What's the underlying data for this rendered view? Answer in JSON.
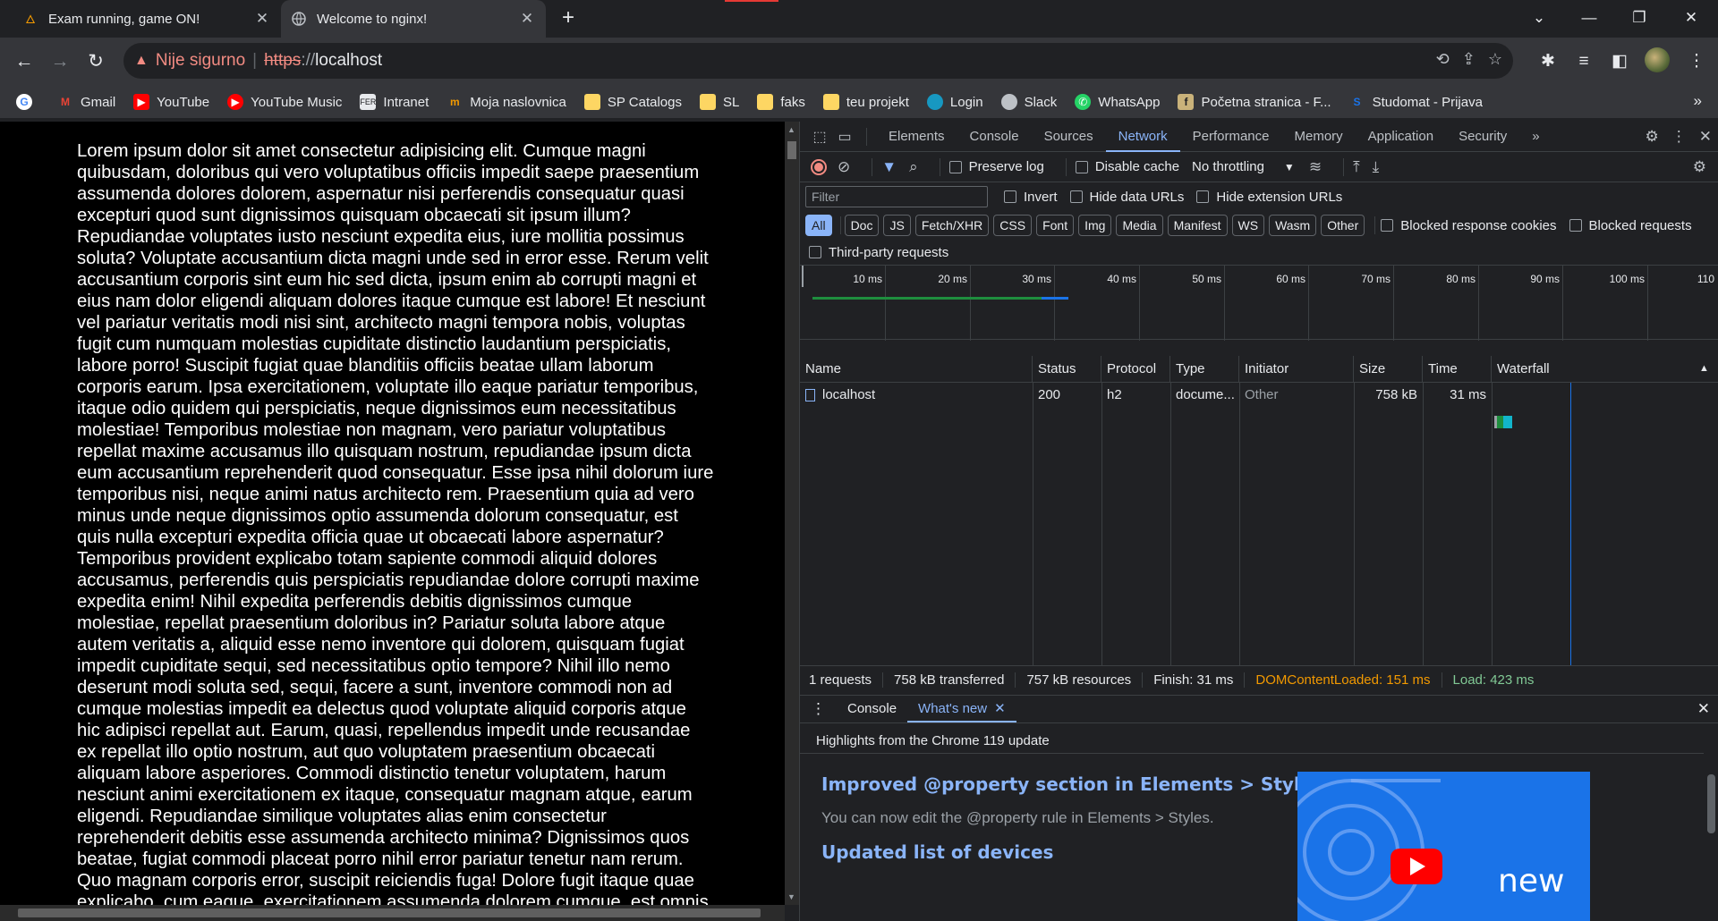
{
  "tabs": [
    {
      "title": "Exam running, game ON!",
      "close": "✕",
      "active": false
    },
    {
      "title": "Welcome to nginx!",
      "close": "✕",
      "active": true
    }
  ],
  "new_tab": "+",
  "window_controls": {
    "dropdown": "⌄",
    "minimize": "—",
    "restore": "❐",
    "close": "✕"
  },
  "nav": {
    "back": "←",
    "forward": "→",
    "reload": "↻"
  },
  "omnibox": {
    "warning_icon": "▲",
    "security_text": "Nije sigurno",
    "separator": "|",
    "scheme": "https",
    "scheme_suffix": "://",
    "host": "localhost"
  },
  "bookmarks": [
    {
      "label": "",
      "icon": "google-icon",
      "color": "#4285f4"
    },
    {
      "label": "Gmail",
      "icon": "gmail-icon",
      "color": "#ea4335"
    },
    {
      "label": "YouTube",
      "icon": "youtube-icon",
      "color": "#ff0000"
    },
    {
      "label": "YouTube Music",
      "icon": "youtube-music-icon",
      "color": "#ff0000"
    },
    {
      "label": "Intranet",
      "icon": "intranet-icon",
      "color": "#e8eaed"
    },
    {
      "label": "Moja naslovnica",
      "icon": "moja-naslovnica-icon",
      "color": "#f29900"
    },
    {
      "label": "SP Catalogs",
      "icon": "folder-icon",
      "color": "#fdd663"
    },
    {
      "label": "SL",
      "icon": "folder-icon",
      "color": "#fdd663"
    },
    {
      "label": "faks",
      "icon": "folder-icon",
      "color": "#fdd663"
    },
    {
      "label": "teu projekt",
      "icon": "folder-icon",
      "color": "#fdd663"
    },
    {
      "label": "Login",
      "icon": "salesforce-icon",
      "color": "#1798c1"
    },
    {
      "label": "Slack",
      "icon": "globe-icon",
      "color": "#bdc1c6"
    },
    {
      "label": "WhatsApp",
      "icon": "whatsapp-icon",
      "color": "#25d366"
    },
    {
      "label": "Početna stranica - F...",
      "icon": "fer-icon",
      "color": "#c9b27a"
    },
    {
      "label": "Studomat - Prijava",
      "icon": "studomat-icon",
      "color": "#1a73e8"
    }
  ],
  "bookmarks_more": "»",
  "page_text": "Lorem ipsum dolor sit amet consectetur adipisicing elit. Cumque magni quibusdam, doloribus qui vero voluptatibus officiis impedit saepe praesentium assumenda dolores dolorem, aspernatur nisi perferendis consequatur quasi excepturi quod sunt dignissimos quisquam obcaecati sit ipsum illum? Repudiandae voluptates iusto nesciunt expedita eius, iure mollitia possimus soluta? Voluptate accusantium dicta magni unde sed in error esse. Rerum velit accusantium corporis sint eum hic sed dicta, ipsum enim ab corrupti magni et eius nam dolor eligendi aliquam dolores itaque cumque est labore! Et nesciunt vel pariatur veritatis modi nisi sint, architecto magni tempora nobis, voluptas fugit cum numquam molestias cupiditate distinctio laudantium perspiciatis, labore porro! Suscipit fugiat quae blanditiis officiis beatae ullam laborum corporis earum. Ipsa exercitationem, voluptate illo eaque pariatur temporibus, itaque odio quidem qui perspiciatis, neque dignissimos eum necessitatibus molestiae! Temporibus molestiae non magnam, vero pariatur voluptatibus repellat maxime accusamus illo quisquam nostrum, repudiandae ipsum dicta eum accusantium reprehenderit quod consequatur. Esse ipsa nihil dolorum iure temporibus nisi, neque animi natus architecto rem. Praesentium quia ad vero minus unde neque dignissimos optio assumenda dolorum consequatur, est quis nulla excepturi expedita officia quae ut obcaecati labore aspernatur? Temporibus provident explicabo totam sapiente commodi aliquid dolores accusamus, perferendis quis perspiciatis repudiandae dolore corrupti maxime expedita enim! Nihil expedita perferendis debitis dignissimos cumque molestiae, repellat praesentium doloribus in? Pariatur soluta labore atque autem veritatis a, aliquid esse nemo inventore qui dolorem, quisquam fugiat impedit cupiditate sequi, sed necessitatibus optio tempore? Nihil illo nemo deserunt modi soluta sed, sequi, facere a sunt, inventore commodi non ad cumque molestias impedit ea delectus quod voluptate aliquid corporis atque hic adipisci repellat aut. Earum, quasi, repellendus impedit unde recusandae ex repellat illo optio nostrum, aut quo voluptatem praesentium obcaecati aliquam labore asperiores. Commodi distinctio tenetur voluptatem, harum nesciunt animi exercitationem ex itaque, consequatur magnam atque, earum eligendi. Repudiandae similique voluptates alias enim consectetur reprehenderit debitis esse assumenda architecto minima? Dignissimos quos beatae, fugiat commodi placeat porro nihil error pariatur tenetur nam rerum. Quo magnam corporis error, suscipit reiciendis fuga! Dolore fugit itaque quae explicabo, cum eaque, exercitationem assumenda dolorem cumque, est omnis. Reprehenderit sed",
  "devtools": {
    "tabs": [
      "Elements",
      "Console",
      "Sources",
      "Network",
      "Performance",
      "Memory",
      "Application",
      "Security"
    ],
    "selected_tab": "Network",
    "more_tabs": "»",
    "network_toolbar": {
      "preserve_log": "Preserve log",
      "disable_cache": "Disable cache",
      "throttling": "No throttling"
    },
    "filter": {
      "placeholder": "Filter",
      "invert": "Invert",
      "hide_data_urls": "Hide data URLs",
      "hide_extension_urls": "Hide extension URLs"
    },
    "types": [
      "All",
      "Doc",
      "JS",
      "Fetch/XHR",
      "CSS",
      "Font",
      "Img",
      "Media",
      "Manifest",
      "WS",
      "Wasm",
      "Other"
    ],
    "selected_type": "All",
    "blocked_response_cookies": "Blocked response cookies",
    "blocked_requests": "Blocked requests",
    "third_party": "Third-party requests",
    "timeline_ticks": [
      "10 ms",
      "20 ms",
      "30 ms",
      "40 ms",
      "50 ms",
      "60 ms",
      "70 ms",
      "80 ms",
      "90 ms",
      "100 ms",
      "110"
    ],
    "table": {
      "headers": [
        "Name",
        "Status",
        "Protocol",
        "Type",
        "Initiator",
        "Size",
        "Time",
        "Waterfall"
      ],
      "rows": [
        {
          "name": "localhost",
          "status": "200",
          "protocol": "h2",
          "type": "docume...",
          "initiator": "Other",
          "size": "758 kB",
          "time": "31 ms"
        }
      ]
    },
    "summary": {
      "requests": "1 requests",
      "transferred": "758 kB transferred",
      "resources": "757 kB resources",
      "finish": "Finish: 31 ms",
      "dcl": "DOMContentLoaded: 151 ms",
      "load": "Load: 423 ms"
    },
    "drawer": {
      "tabs": [
        "Console",
        "What's new"
      ],
      "selected": "What's new",
      "subtitle": "Highlights from the Chrome 119 update",
      "heading1": "Improved @property section in Elements > Styles",
      "para1": "You can now edit the @property rule in Elements > Styles.",
      "heading2": "Updated list of devices",
      "image_label": "new"
    }
  },
  "colors": {
    "accent": "#8ab4f8",
    "warning": "#f28b82",
    "dcl": "#f29900",
    "load": "#81c995"
  }
}
